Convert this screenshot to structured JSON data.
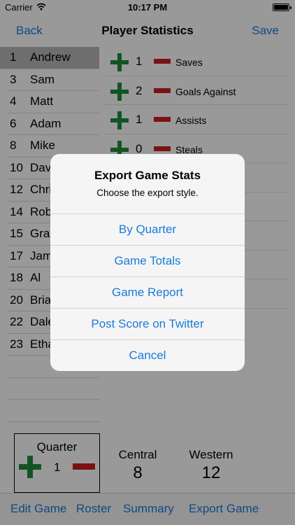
{
  "status_bar": {
    "carrier": "Carrier",
    "time": "10:17 PM"
  },
  "nav": {
    "back_label": "Back",
    "title": "Player Statistics",
    "save_label": "Save"
  },
  "roster": [
    {
      "number": "1",
      "name": "Andrew",
      "selected": true
    },
    {
      "number": "3",
      "name": "Sam"
    },
    {
      "number": "4",
      "name": "Matt"
    },
    {
      "number": "6",
      "name": "Adam"
    },
    {
      "number": "8",
      "name": "Mike"
    },
    {
      "number": "10",
      "name": "Dav"
    },
    {
      "number": "12",
      "name": "Chri"
    },
    {
      "number": "14",
      "name": "Rob"
    },
    {
      "number": "15",
      "name": "Gra"
    },
    {
      "number": "17",
      "name": "Jam"
    },
    {
      "number": "18",
      "name": "Al"
    },
    {
      "number": "20",
      "name": "Bria"
    },
    {
      "number": "22",
      "name": "Dale"
    },
    {
      "number": "23",
      "name": "Etha"
    }
  ],
  "stats": [
    {
      "count": "1",
      "label": "Saves"
    },
    {
      "count": "2",
      "label": "Goals Against"
    },
    {
      "count": "1",
      "label": "Assists"
    },
    {
      "count": "0",
      "label": "Steals"
    },
    {
      "count": "",
      "label": ""
    },
    {
      "count": "",
      "label": ""
    },
    {
      "count": "",
      "label": ""
    },
    {
      "count": "",
      "label": ""
    },
    {
      "count": "",
      "label": "nst"
    }
  ],
  "quarter": {
    "label": "Quarter",
    "value": "1"
  },
  "teams": {
    "home": {
      "name": "Central",
      "score": "8"
    },
    "away": {
      "name": "Western",
      "score": "12"
    }
  },
  "toolbar": {
    "edit_game": "Edit Game",
    "roster": "Roster",
    "summary": "Summary",
    "export_game": "Export Game"
  },
  "alert": {
    "title": "Export Game Stats",
    "message": "Choose the export style.",
    "buttons": [
      "By Quarter",
      "Game Totals",
      "Game Report",
      "Post Score on Twitter",
      "Cancel"
    ]
  },
  "colors": {
    "accent": "#1a7ad9",
    "plus": "#1e8c3c",
    "minus": "#cc1f1f",
    "selected_row": "#b8b8b8"
  }
}
